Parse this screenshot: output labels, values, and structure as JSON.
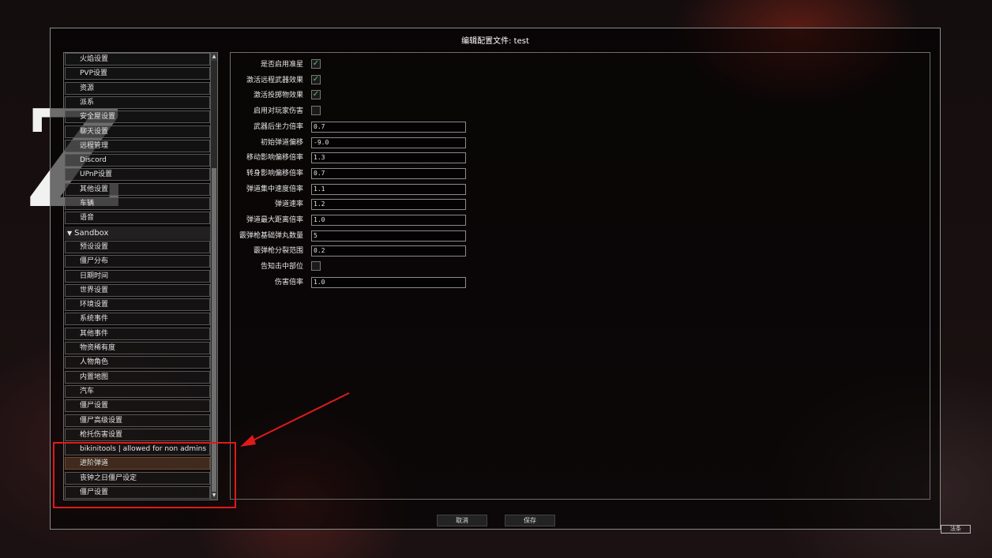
{
  "dialog": {
    "title": "编辑配置文件: test"
  },
  "sidebar": {
    "items_before": [
      "火焰设置",
      "PVP设置",
      "资源",
      "派系",
      "安全屋设置",
      "聊天设置",
      "远程管理",
      "Discord",
      "UPnP设置",
      "其他设置",
      "车辆",
      "语音"
    ],
    "group": {
      "label": "Sandbox",
      "icon": "triangle-down-icon"
    },
    "items_after": [
      "预设设置",
      "僵尸分布",
      "日期时间",
      "世界设置",
      "环境设置",
      "系统事件",
      "其他事件",
      "物资稀有度",
      "人物角色",
      "内置地图",
      "汽车",
      "僵尸设置",
      "僵尸高级设置",
      "枪托伤害设置",
      "bikinitools | allowed for non admins",
      "进阶弹道",
      "丧钟之日僵尸设定",
      "僵尸设置"
    ],
    "selected_index": 15,
    "scroll_up": "▲",
    "scroll_down": "▼"
  },
  "settings": [
    {
      "label": "是否启用准星",
      "type": "checkbox",
      "checked": true
    },
    {
      "label": "激活远程武器效果",
      "type": "checkbox",
      "checked": true
    },
    {
      "label": "激活投掷物效果",
      "type": "checkbox",
      "checked": true
    },
    {
      "label": "启用对玩家伤害",
      "type": "checkbox",
      "checked": false
    },
    {
      "label": "武器后坐力倍率",
      "type": "text",
      "value": "0.7"
    },
    {
      "label": "初始弹道偏移",
      "type": "text",
      "value": "-9.0"
    },
    {
      "label": "移动影响偏移倍率",
      "type": "text",
      "value": "1.3"
    },
    {
      "label": "转身影响偏移倍率",
      "type": "text",
      "value": "0.7"
    },
    {
      "label": "弹道集中速度倍率",
      "type": "text",
      "value": "1.1"
    },
    {
      "label": "弹道速率",
      "type": "text",
      "value": "1.2"
    },
    {
      "label": "弹道最大距离倍率",
      "type": "text",
      "value": "1.0"
    },
    {
      "label": "霰弹枪基础弹丸数量",
      "type": "text",
      "value": "5"
    },
    {
      "label": "霰弹枪分裂范围",
      "type": "text",
      "value": "0.2"
    },
    {
      "label": "告知击中部位",
      "type": "checkbox",
      "checked": false
    },
    {
      "label": "伤害倍率",
      "type": "text",
      "value": "1.0"
    }
  ],
  "buttons": {
    "cancel": "取消",
    "save": "保存"
  },
  "corner_button": "法条",
  "check_glyph": "✓",
  "colors": {
    "annotation_red": "#e01a1a",
    "check_green": "#5ac16a",
    "selected_bg": "#3f2a1d"
  }
}
